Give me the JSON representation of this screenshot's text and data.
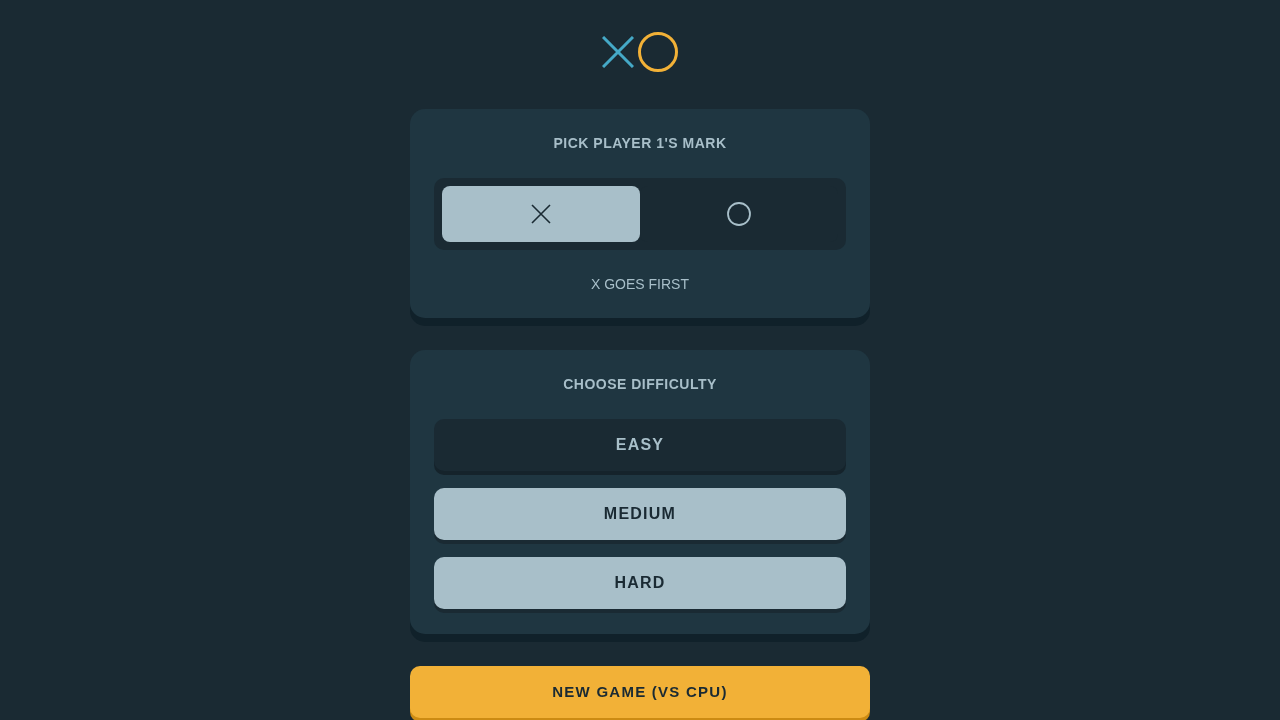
{
  "mark_picker": {
    "title": "PICK PLAYER 1'S MARK",
    "options": [
      {
        "kind": "x",
        "selected": true
      },
      {
        "kind": "o",
        "selected": false
      }
    ],
    "note": "X GOES FIRST"
  },
  "difficulty": {
    "title": "CHOOSE DIFFICULTY",
    "options": [
      {
        "label": "EASY",
        "selected": true
      },
      {
        "label": "MEDIUM",
        "selected": false
      },
      {
        "label": "HARD",
        "selected": false
      }
    ]
  },
  "new_game_button": {
    "label": "NEW GAME (VS CPU)"
  }
}
